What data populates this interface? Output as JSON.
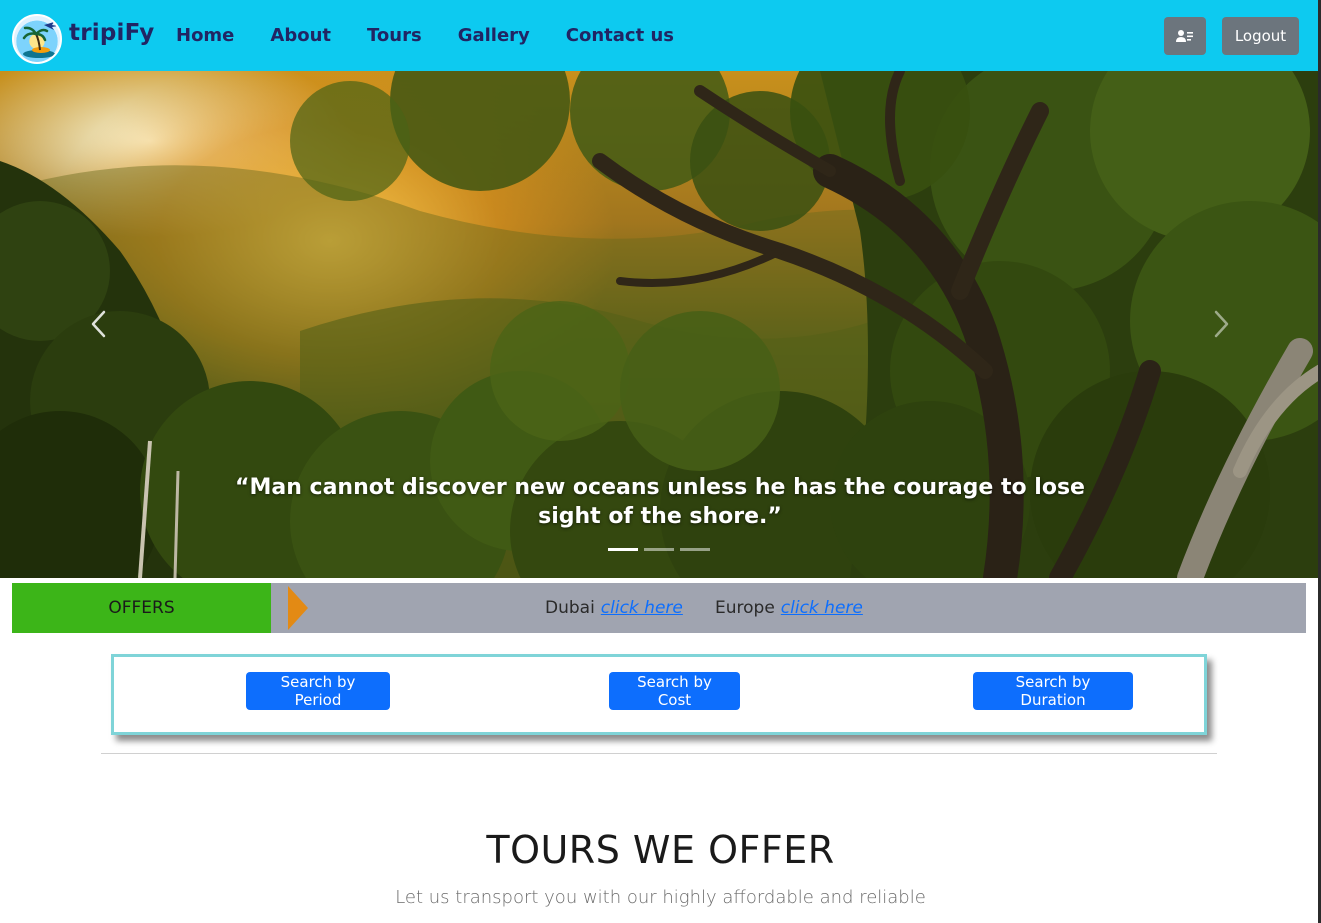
{
  "brand": {
    "name": "tripiFy"
  },
  "nav": {
    "links": [
      {
        "label": "Home"
      },
      {
        "label": "About"
      },
      {
        "label": "Tours"
      },
      {
        "label": "Gallery"
      },
      {
        "label": "Contact us"
      }
    ],
    "logout_label": "Logout"
  },
  "hero": {
    "caption": "“Man cannot discover new oceans unless he has the courage to lose sight of the shore.”",
    "slides_count": 3,
    "active_slide": 1
  },
  "offers": {
    "label": "OFFERS",
    "items": [
      {
        "name": "Dubai",
        "link": "click here"
      },
      {
        "name": "Europe",
        "link": "click here"
      }
    ]
  },
  "search": {
    "period_label": "Search by Period",
    "cost_label": "Search by Cost",
    "duration_label": "Search by Duration"
  },
  "tours": {
    "title": "TOURS WE OFFER",
    "subtitle": "Let us transport you with our highly affordable and reliable"
  },
  "colors": {
    "navbar": "#0dcaf0",
    "brand_text": "#212563",
    "offers_green": "#3cb518",
    "offers_bar": "#a0a4b0",
    "offers_arrow": "#e38a14",
    "primary_button": "#0d6efd",
    "secondary_button": "#6c757d",
    "search_border": "#7fd4d8"
  },
  "icons": {
    "profile": "user-card-icon",
    "prev": "chevron-left-icon",
    "next": "chevron-right-icon",
    "logo": "island-plane-logo-icon"
  }
}
